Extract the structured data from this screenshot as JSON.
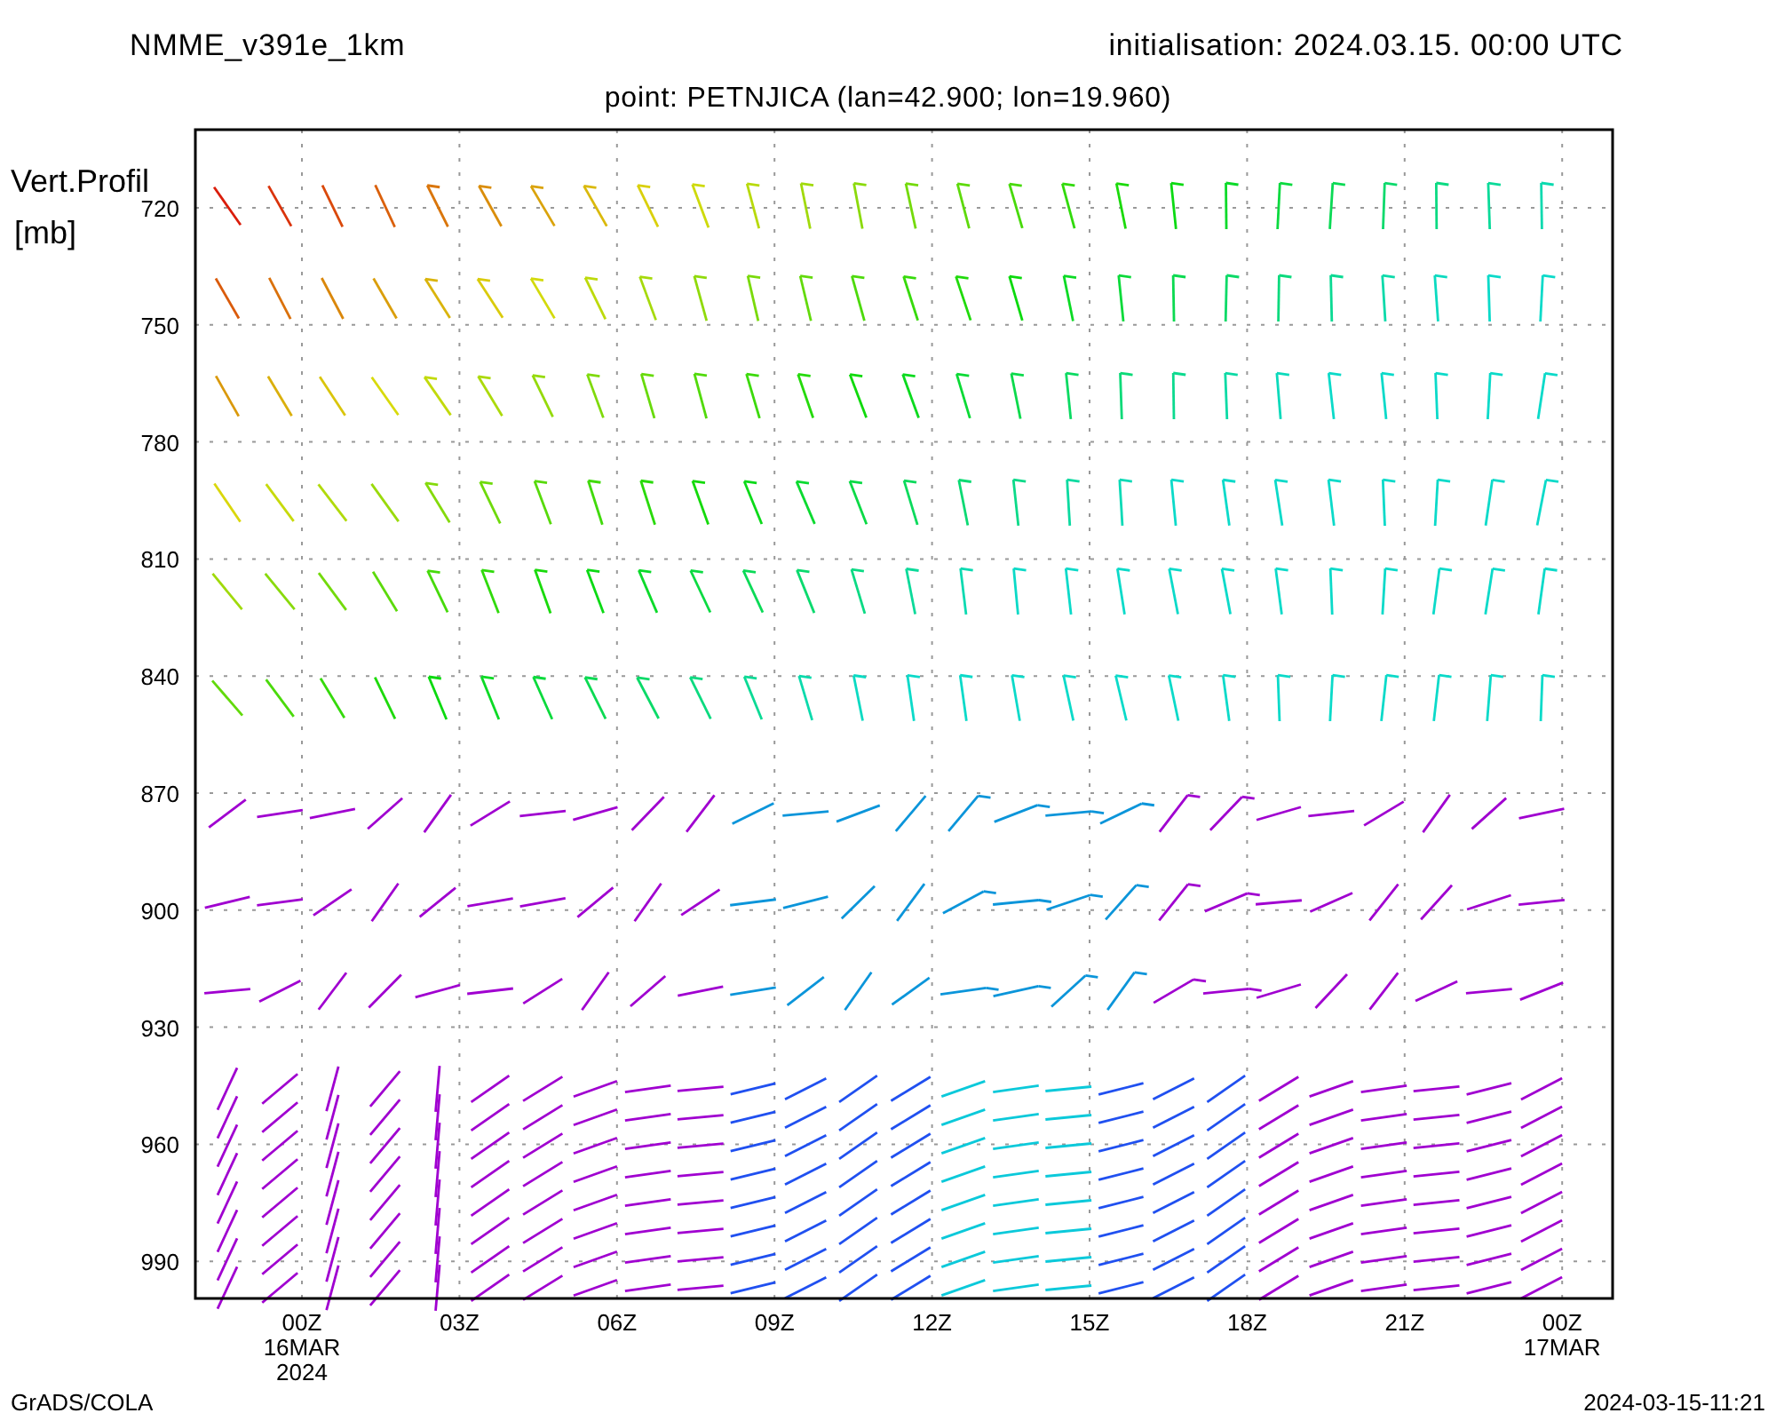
{
  "header": {
    "model": "NMME_v391e_1km",
    "initialisation": "initialisation: 2024.03.15. 00:00 UTC"
  },
  "point": "point: PETNJICA (lan=42.900; lon=19.960)",
  "y_axis": {
    "label": [
      "Vert.Profil",
      "[mb]"
    ],
    "ticks": [
      "720",
      "750",
      "780",
      "810",
      "840",
      "870",
      "900",
      "930",
      "960",
      "990"
    ]
  },
  "x_axis": {
    "ticks": [
      [
        "00Z",
        "16MAR",
        "2024"
      ],
      [
        "03Z"
      ],
      [
        "06Z"
      ],
      [
        "09Z"
      ],
      [
        "12Z"
      ],
      [
        "15Z"
      ],
      [
        "18Z"
      ],
      [
        "21Z"
      ],
      [
        "00Z",
        "17MAR"
      ]
    ]
  },
  "footer": {
    "left": "GrADS/COLA",
    "right": "2024-03-15-11:21"
  }
}
